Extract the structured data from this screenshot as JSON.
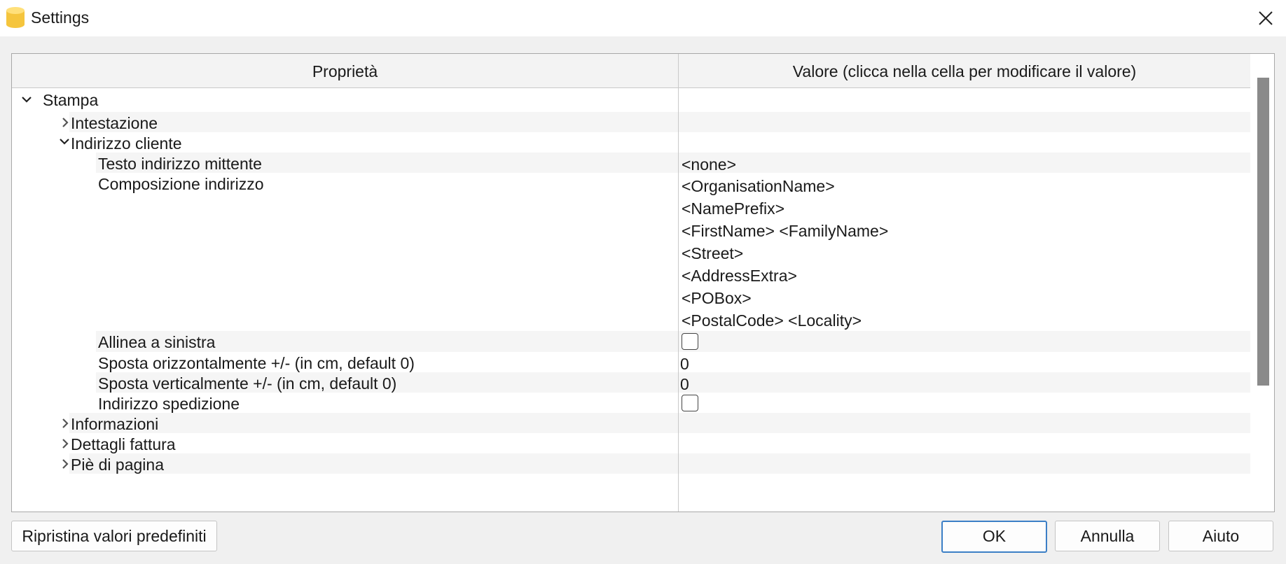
{
  "window": {
    "title": "Settings",
    "app_icon": "database-cylinder-icon",
    "app_icon_color": "#f5c53d",
    "close_icon": "close-icon"
  },
  "table": {
    "columns": {
      "property": "Proprietà",
      "value": "Valore (clicca nella cella per modificare il valore)"
    },
    "rows": [
      {
        "label": "Stampa",
        "expanded": true
      },
      {
        "label": "Intestazione",
        "expanded": false
      },
      {
        "label": "Indirizzo cliente",
        "expanded": true
      },
      {
        "label": "Testo indirizzo mittente",
        "value": "<none>"
      },
      {
        "label": "Composizione indirizzo",
        "value_lines": [
          "<OrganisationName>",
          "<NamePrefix>",
          "<FirstName> <FamilyName>",
          "<Street>",
          "<AddressExtra>",
          "<POBox>",
          "<PostalCode> <Locality>"
        ]
      },
      {
        "label": "Allinea a sinistra",
        "checked": false
      },
      {
        "label": "Sposta orizzontalmente +/- (in cm, default 0)",
        "value": "0"
      },
      {
        "label": "Sposta verticalmente +/- (in cm, default 0)",
        "value": "0"
      },
      {
        "label": "Indirizzo spedizione",
        "checked": false
      },
      {
        "label": "Informazioni",
        "expanded": false
      },
      {
        "label": "Dettagli fattura",
        "expanded": false
      },
      {
        "label": "Piè di pagina",
        "expanded": false
      }
    ]
  },
  "buttons": {
    "reset": "Ripristina valori predefiniti",
    "ok": "OK",
    "cancel": "Annulla",
    "help": "Aiuto"
  }
}
